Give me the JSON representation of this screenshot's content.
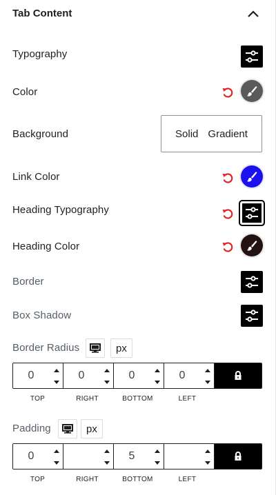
{
  "panel": {
    "title": "Tab Content",
    "collapse_icon": "chevron-up-icon"
  },
  "rows": {
    "typography": {
      "label": "Typography",
      "icon": "sliders-icon"
    },
    "color": {
      "label": "Color",
      "swatch": "#5a5a5a",
      "reset_icon": "reset-icon"
    },
    "background": {
      "label": "Background",
      "options": [
        "Solid",
        "Gradient"
      ]
    },
    "link_color": {
      "label": "Link Color",
      "swatch": "#1a10f0"
    },
    "heading_typography": {
      "label": "Heading Typography",
      "icon": "sliders-icon"
    },
    "heading_color": {
      "label": "Heading Color",
      "swatch": "#241212"
    },
    "border": {
      "label": "Border",
      "icon": "sliders-icon"
    },
    "box_shadow": {
      "label": "Box Shadow",
      "icon": "sliders-icon"
    }
  },
  "border_radius": {
    "label": "Border Radius",
    "device_icon": "desktop-icon",
    "unit": "px",
    "top": "0",
    "right": "0",
    "bottom": "0",
    "left": "0"
  },
  "padding": {
    "label": "Padding",
    "device_icon": "desktop-icon",
    "unit": "px",
    "top": "0",
    "right": "",
    "bottom": "5",
    "left": ""
  },
  "dimension_labels": [
    "TOP",
    "RIGHT",
    "BOTTOM",
    "LEFT"
  ],
  "colors": {
    "reset_red": "#e22222",
    "dark": "#000000"
  }
}
